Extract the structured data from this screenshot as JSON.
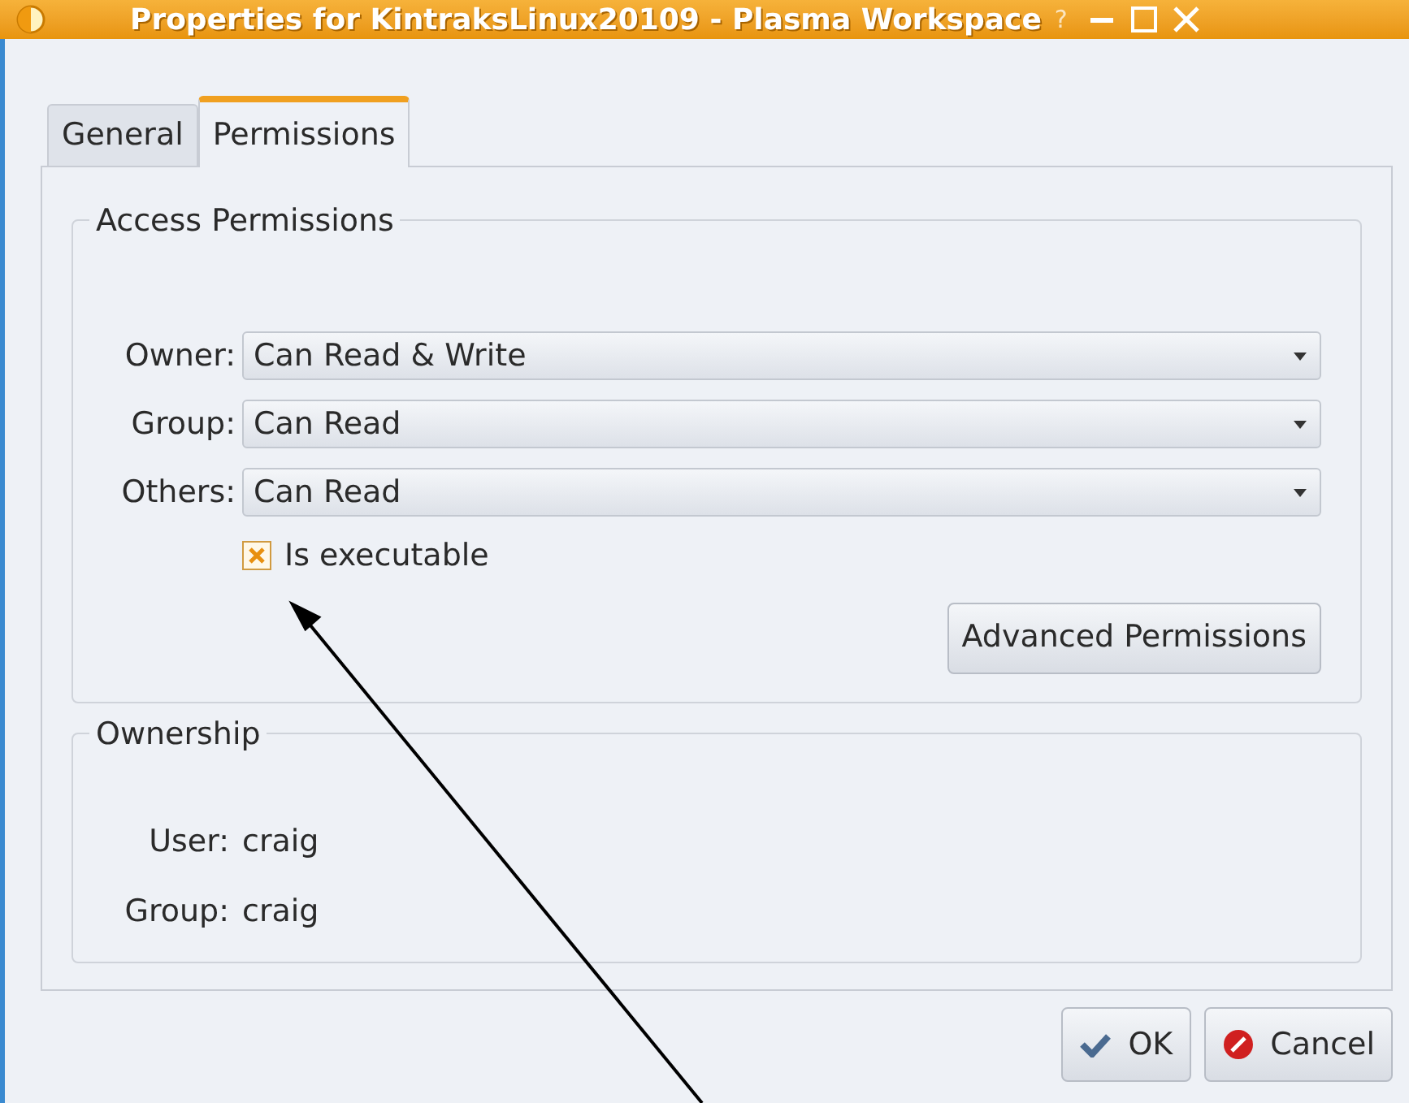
{
  "window": {
    "title": "Properties for KintraksLinux20109 - Plasma Workspace",
    "help_glyph": "?"
  },
  "tabs": [
    {
      "label": "General",
      "selected": false
    },
    {
      "label": "Permissions",
      "selected": true
    }
  ],
  "access_permissions": {
    "title": "Access Permissions",
    "rows": [
      {
        "label": "Owner:",
        "value": "Can Read & Write"
      },
      {
        "label": "Group:",
        "value": "Can Read"
      },
      {
        "label": "Others:",
        "value": "Can Read"
      }
    ],
    "executable": {
      "label": "Is executable",
      "checked": true
    },
    "advanced_button": "Advanced Permissions"
  },
  "ownership": {
    "title": "Ownership",
    "rows": [
      {
        "label": "User:",
        "value": "craig"
      },
      {
        "label": "Group:",
        "value": "craig"
      }
    ]
  },
  "buttons": [
    {
      "kind": "ok",
      "label": "OK"
    },
    {
      "kind": "cancel",
      "label": "Cancel"
    }
  ]
}
